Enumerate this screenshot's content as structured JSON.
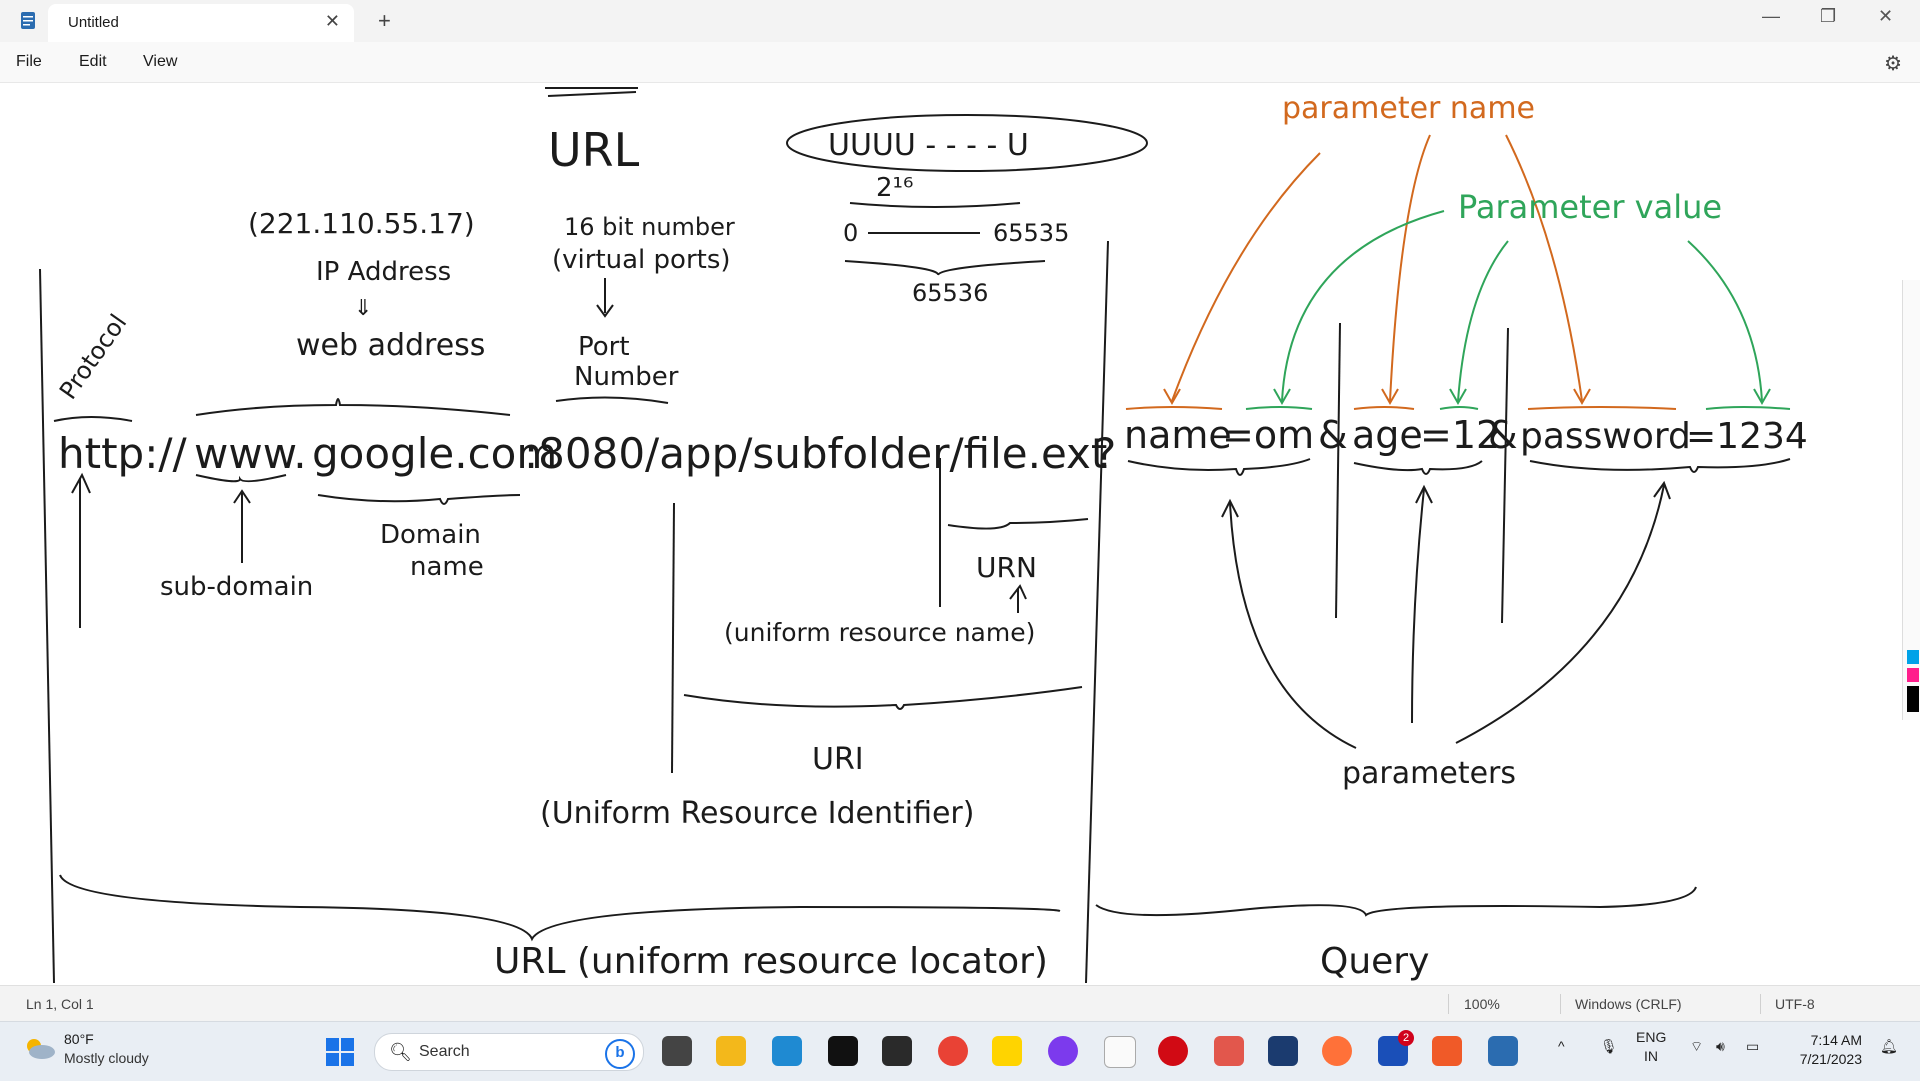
{
  "window": {
    "tab_title": "Untitled",
    "new_tab_label": "+",
    "close_tab_label": "✕"
  },
  "menu": {
    "file": "File",
    "edit": "Edit",
    "view": "View"
  },
  "sketch": {
    "title": "URL",
    "bits_box": "ᑌᑌᑌᑌ - - - - ᑌ",
    "two_pow": "2¹⁶",
    "range_start": "0",
    "range_end": "65535",
    "range_count": "65536",
    "ip": "(221.110.55.17)",
    "ip_label": "IP Address",
    "ip_arrow": "⇓",
    "web_address": "web address",
    "port_note_1": "16 bit number",
    "port_note_2": "(virtual ports)",
    "port_number_1": "Port",
    "port_number_2": "Number",
    "protocol": "Protocol",
    "url_line_1": "http://",
    "url_line_2": "www.",
    "url_line_3": "google.com",
    "url_line_4": ":8080/app/subfolder/file.ext",
    "url_line_5": "?",
    "q1": "name",
    "q2": "=om",
    "q3": "&",
    "q4": "age",
    "q5": "=12",
    "q6": "&",
    "q7": "password",
    "q8": "=1234",
    "subdomain": "sub-domain",
    "domain_1": "Domain",
    "domain_2": "name",
    "urn": "URN",
    "urn_full": "(uniform resource name)",
    "uri": "URI",
    "uri_full": "(Uniform Resource Identifier)",
    "url_full": "URL (uniform resource locator)",
    "param_name": "parameter name",
    "param_value": "Parameter value",
    "parameters": "parameters",
    "query": "Query"
  },
  "status": {
    "position": "Ln 1, Col 1",
    "zoom": "100%",
    "line_ending": "Windows (CRLF)",
    "encoding": "UTF-8"
  },
  "taskbar": {
    "temp": "80°F",
    "weather": "Mostly cloudy",
    "search_placeholder": "Search",
    "badge": "2",
    "lang_1": "ENG",
    "lang_2": "IN",
    "time": "7:14 AM",
    "date": "7/21/2023"
  },
  "colors": {
    "ink": "#1b1b1b",
    "orange": "#d2691e",
    "green": "#2fa55a",
    "accent": "#1a73e8"
  }
}
